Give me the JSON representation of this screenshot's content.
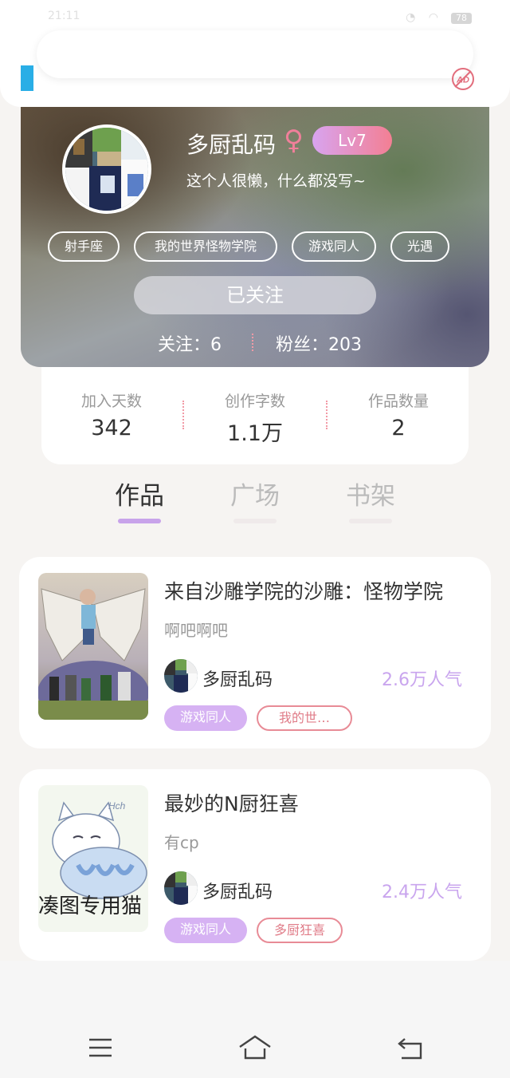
{
  "status_bar": {
    "time": "21:11",
    "battery": "78"
  },
  "profile": {
    "nickname": "多厨乱码",
    "gender_symbol": "♀",
    "level": "Lv7",
    "bio": "这个人很懒，什么都没写~",
    "tags": [
      "射手座",
      "我的世界怪物学院",
      "游戏同人",
      "光遇"
    ],
    "follow_button": "已关注",
    "following": "关注：6",
    "fans": "粉丝：203"
  },
  "stats": [
    {
      "label": "加入天数",
      "value": "342"
    },
    {
      "label": "创作字数",
      "value": "1.1万"
    },
    {
      "label": "作品数量",
      "value": "2"
    }
  ],
  "tabs": [
    {
      "label": "作品",
      "active": true
    },
    {
      "label": "广场",
      "active": false
    },
    {
      "label": "书架",
      "active": false
    }
  ],
  "works": [
    {
      "title": "来自沙雕学院的沙雕：怪物学院",
      "desc": "啊吧啊吧",
      "author": "多厨乱码",
      "popularity": "2.6万人气",
      "tags": [
        "游戏同人",
        "我的世…"
      ]
    },
    {
      "title": "最妙的N厨狂喜",
      "desc": "有cp",
      "author": "多厨乱码",
      "popularity": "2.4万人气",
      "tags": [
        "游戏同人",
        "多厨狂喜"
      ]
    }
  ],
  "cover_text": {
    "cat_caption": "凑图专用猫",
    "cat_signature": "Hch"
  },
  "icons": {
    "ad_block": "no-ad-icon",
    "nav": [
      "menu-icon",
      "home-icon",
      "back-icon"
    ]
  },
  "colors": {
    "accent_purple": "#c8a3ea",
    "tag_pink": "#e88b96",
    "level_gradient_start": "#d8a4f0",
    "level_gradient_end": "#f37f93"
  }
}
